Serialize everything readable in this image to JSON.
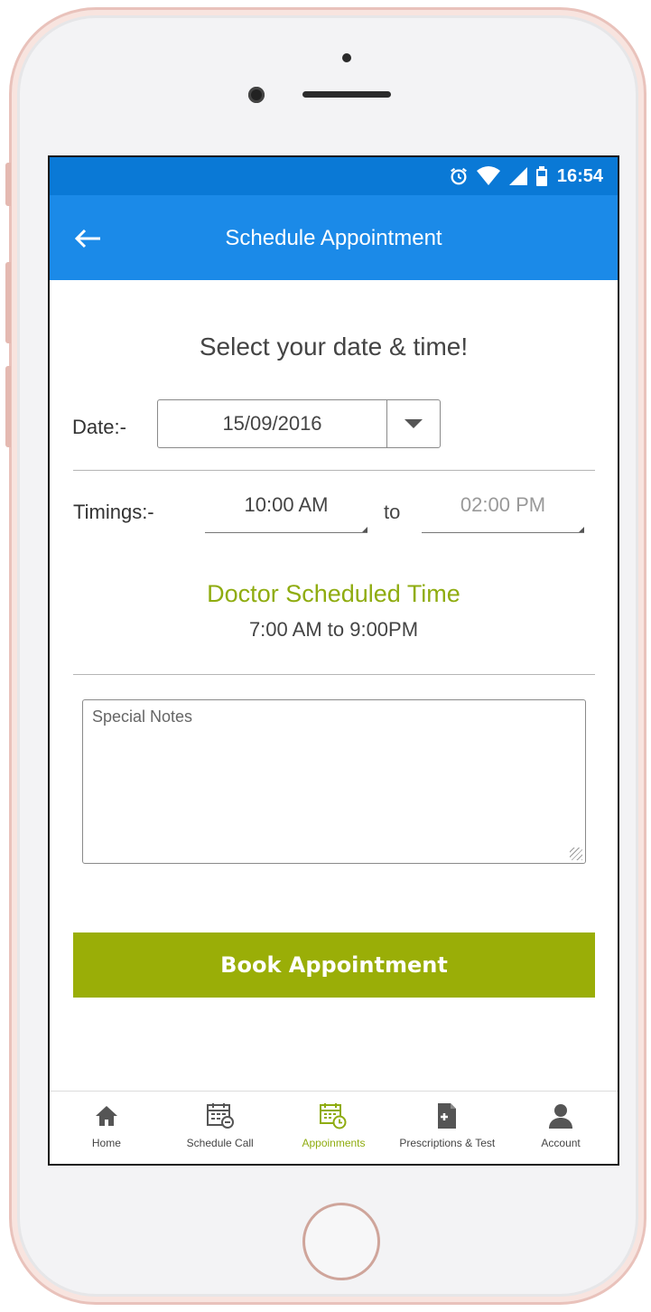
{
  "status_bar": {
    "time": "16:54",
    "icons": [
      "alarm-icon",
      "wifi-icon",
      "signal-icon",
      "battery-icon"
    ]
  },
  "app_bar": {
    "title": "Schedule Appointment",
    "back_icon": "arrow-left-icon"
  },
  "form": {
    "heading": "Select your date & time!",
    "date_label": "Date:-",
    "date_value": "15/09/2016",
    "timings_label": "Timings:-",
    "time_start": "10:00 AM",
    "to_label": "to",
    "time_end": "02:00 PM",
    "doctor_title": "Doctor Scheduled Time",
    "doctor_time": "7:00 AM to 9:00PM",
    "notes_placeholder": "Special Notes",
    "book_label": "Book Appointment"
  },
  "bottom_nav": [
    {
      "label": "Home",
      "icon": "home-icon"
    },
    {
      "label": "Schedule Call",
      "icon": "schedule-call-icon"
    },
    {
      "label": "Appoinments",
      "icon": "calendar-clock-icon",
      "active": true
    },
    {
      "label": "Prescriptions & Test",
      "icon": "prescription-icon"
    },
    {
      "label": "Account",
      "icon": "account-icon"
    }
  ],
  "colors": {
    "status_bar": "#0a79d6",
    "app_bar": "#1b8ae8",
    "accent_green": "#9aae07",
    "doctor_title": "#8fac10"
  }
}
